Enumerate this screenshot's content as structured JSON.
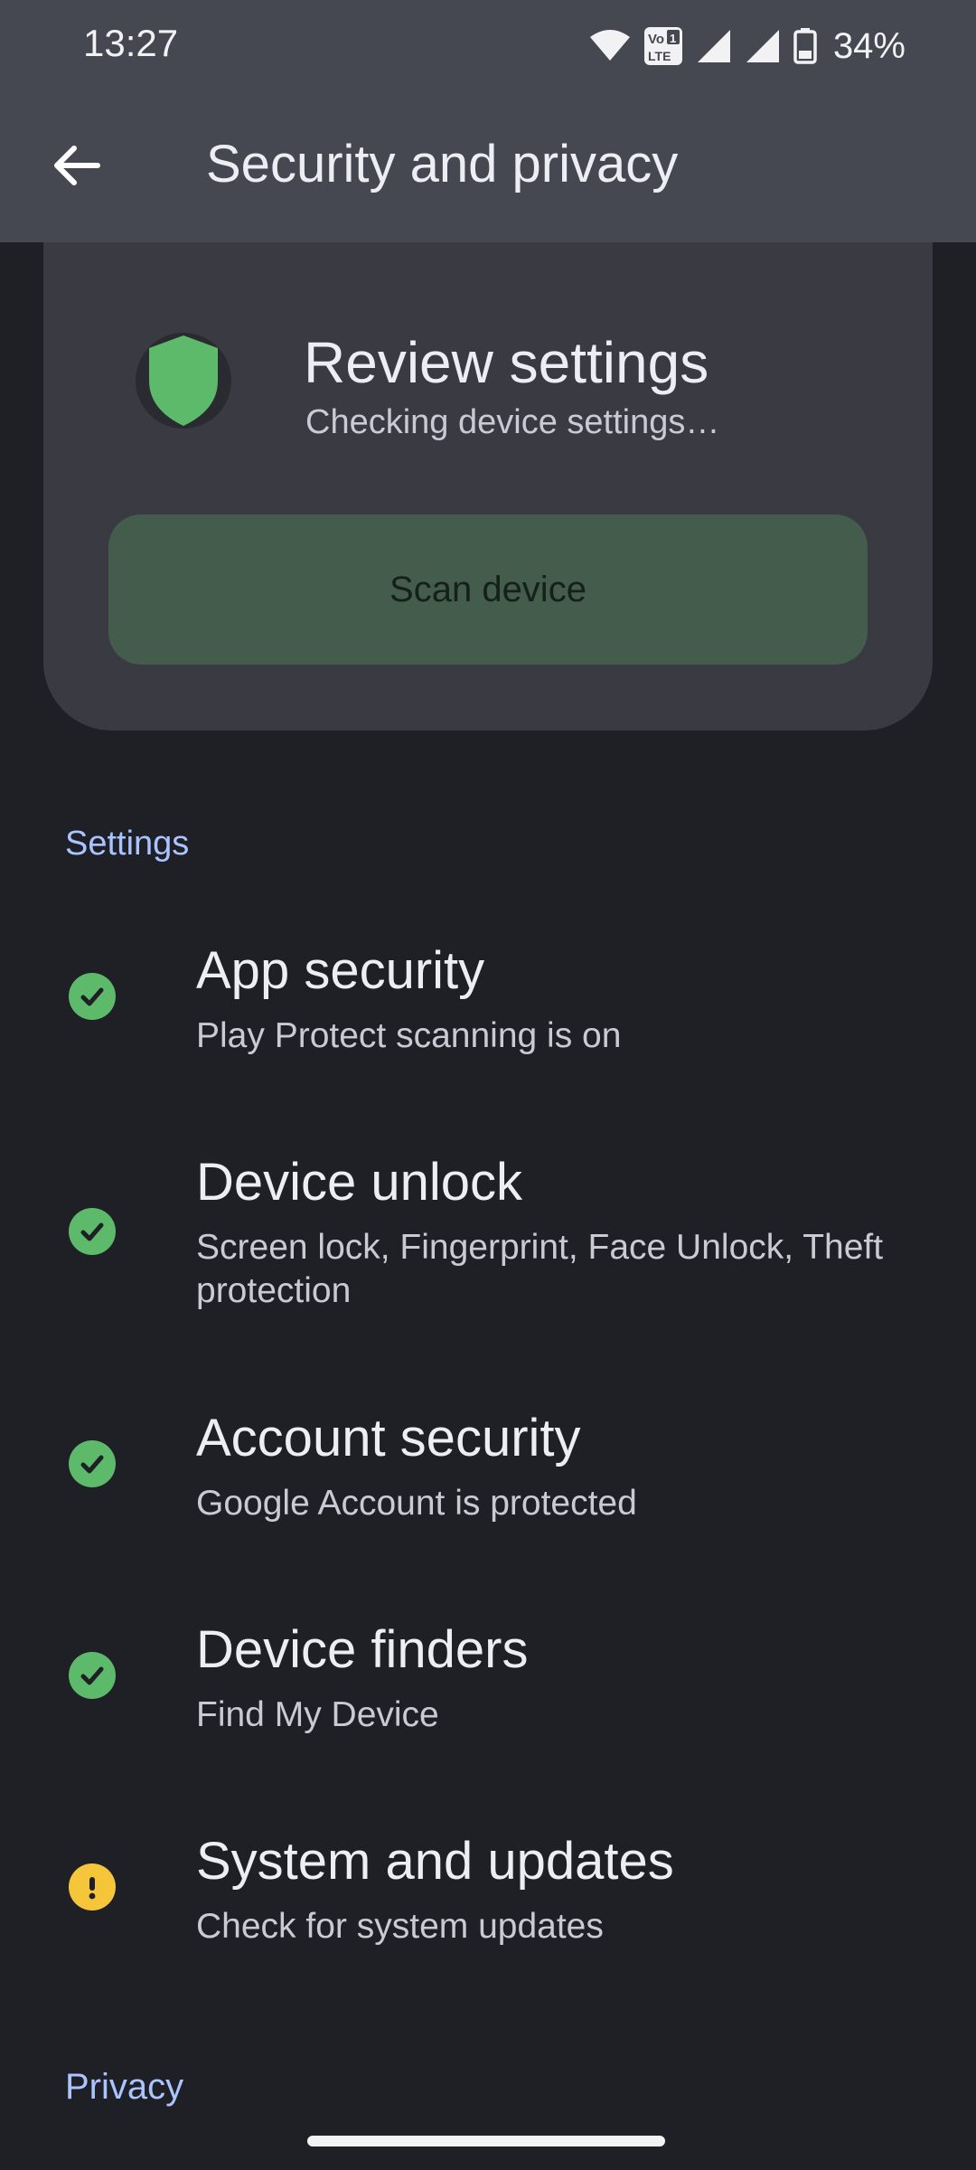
{
  "status_bar": {
    "time": "13:27",
    "network_badge_top": "Vo",
    "network_badge_right": "1",
    "network_badge_bottom": "LTE",
    "battery_percent": "34%"
  },
  "header": {
    "title": "Security and privacy",
    "back_icon": "arrow-back-icon"
  },
  "review_card": {
    "icon": "shield-icon",
    "title": "Review settings",
    "subtitle": "Checking device settings…",
    "scan_button_label": "Scan device",
    "accent_color": "#5dba6b"
  },
  "settings_section": {
    "header": "Settings",
    "items": [
      {
        "title": "App security",
        "summary": "Play Protect scanning is on",
        "status": "ok"
      },
      {
        "title": "Device unlock",
        "summary": "Screen lock, Fingerprint, Face Unlock, Theft protection",
        "status": "ok"
      },
      {
        "title": "Account security",
        "summary": "Google Account is protected",
        "status": "ok"
      },
      {
        "title": "Device finders",
        "summary": "Find My Device",
        "status": "ok"
      },
      {
        "title": "System and updates",
        "summary": "Check for system updates",
        "status": "warning"
      }
    ]
  },
  "privacy_section": {
    "header": "Privacy"
  },
  "colors": {
    "ok": "#5dba6b",
    "warning": "#f5c53a",
    "section_header": "#a9c4ff"
  }
}
